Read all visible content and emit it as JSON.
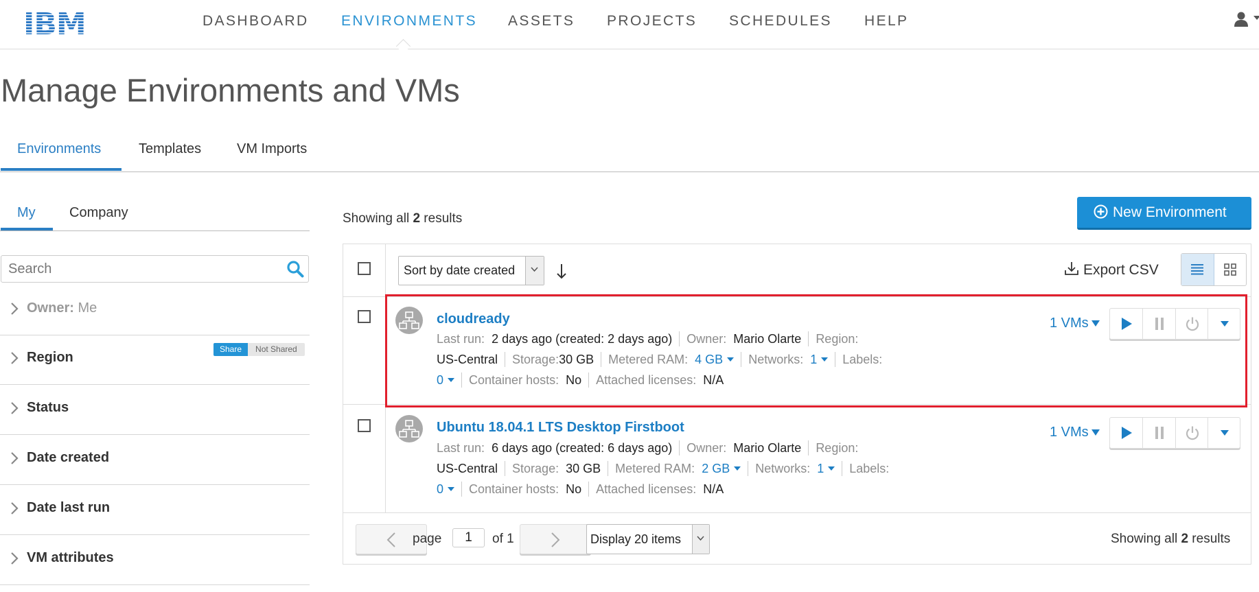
{
  "app": {
    "logo_text": "IBM",
    "accent_color": "#2b93d3",
    "highlight_color": "#e11f2d"
  },
  "nav": {
    "items": [
      {
        "label": "DASHBOARD",
        "active": false
      },
      {
        "label": "ENVIRONMENTS",
        "active": true
      },
      {
        "label": "ASSETS",
        "active": false
      },
      {
        "label": "PROJECTS",
        "active": false
      },
      {
        "label": "SCHEDULES",
        "active": false
      },
      {
        "label": "HELP",
        "active": false
      }
    ],
    "user_icon": "user-icon"
  },
  "page": {
    "title": "Manage Environments and VMs"
  },
  "tabs": [
    {
      "label": "Environments",
      "active": true
    },
    {
      "label": "Templates",
      "active": false
    },
    {
      "label": "VM Imports",
      "active": false
    }
  ],
  "sidebar": {
    "scope_tabs": [
      {
        "label": "My",
        "active": true
      },
      {
        "label": "Company",
        "active": false
      }
    ],
    "search": {
      "placeholder": "Search",
      "value": ""
    },
    "facets": [
      {
        "label": "Owner:",
        "value": "Me"
      },
      {
        "label": "Region"
      },
      {
        "label": "Status"
      },
      {
        "label": "Date created"
      },
      {
        "label": "Date last run"
      },
      {
        "label": "VM attributes"
      }
    ],
    "share_toggle": {
      "on_label": "Share",
      "off_label": "Not Shared"
    }
  },
  "main": {
    "showing_prefix": "Showing all ",
    "result_count": "2",
    "showing_suffix": " results",
    "new_button_label": "New Environment",
    "sort_label": "Sort by date created",
    "export_label": "Export CSV",
    "environments": [
      {
        "name": "cloudready",
        "last_run_label": "Last run:",
        "last_run": "2 days ago (created: 2 days ago)",
        "owner_label": "Owner:",
        "owner": "Mario Olarte",
        "region_label": "Region:",
        "region": "US-Central",
        "storage_label": "Storage:",
        "storage": "30 GB",
        "ram_label": "Metered RAM:",
        "ram": "4 GB",
        "networks_label": "Networks:",
        "networks": "1",
        "labels_label": "Labels:",
        "labels": "0",
        "container_label": "Container hosts:",
        "container": "No",
        "licenses_label": "Attached licenses:",
        "licenses": "N/A",
        "vms": "1 VMs",
        "highlighted": true
      },
      {
        "name": "Ubuntu 18.04.1 LTS Desktop Firstboot",
        "last_run_label": "Last run:",
        "last_run": "6 days ago (created: 6 days ago)",
        "owner_label": "Owner:",
        "owner": "Mario Olarte",
        "region_label": "Region:",
        "region": "US-Central",
        "storage_label": "Storage:",
        "storage": "30 GB",
        "ram_label": "Metered RAM:",
        "ram": "2 GB",
        "networks_label": "Networks:",
        "networks": "1",
        "labels_label": "Labels:",
        "labels": "0",
        "container_label": "Container hosts:",
        "container": "No",
        "licenses_label": "Attached licenses:",
        "licenses": "N/A",
        "vms": "1 VMs",
        "highlighted": false
      }
    ],
    "pagination": {
      "page_label": "page",
      "page_value": "1",
      "of_label": "of 1",
      "display_label": "Display 20 items"
    }
  }
}
